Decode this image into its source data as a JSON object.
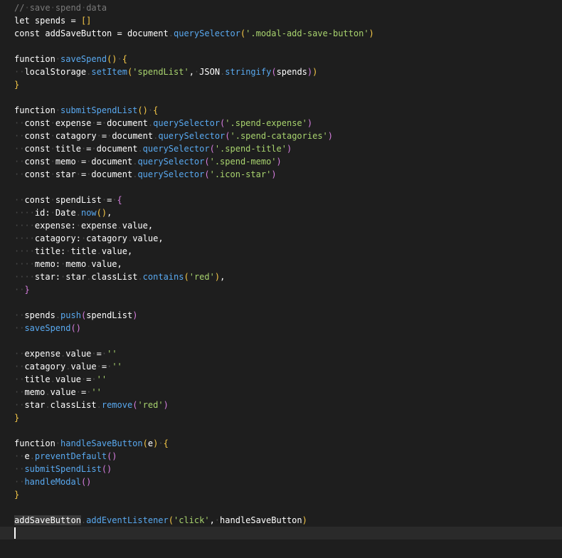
{
  "editor": {
    "colors": {
      "background": "#1e1e1e",
      "current_line": "#2a2a2a",
      "comment": "#7a7a7a",
      "function": "#59a9f0",
      "string": "#a8d36e",
      "paren": "#f7c948",
      "paren_nested": "#d77fe0",
      "whitespace": "#4a4a4a"
    },
    "lines": [
      [
        {
          "t": "//",
          "c": "comment"
        },
        {
          "t": "·",
          "c": "dot"
        },
        {
          "t": "save",
          "c": "comment"
        },
        {
          "t": "·",
          "c": "dot"
        },
        {
          "t": "spend",
          "c": "comment"
        },
        {
          "t": "·",
          "c": "dot"
        },
        {
          "t": "data",
          "c": "comment"
        }
      ],
      [
        {
          "t": "let",
          "c": "kw"
        },
        {
          "t": " spends = ",
          "c": "plain"
        },
        {
          "t": "[]",
          "c": "bracket"
        }
      ],
      [
        {
          "t": "const",
          "c": "kw"
        },
        {
          "t": " addSaveButton ",
          "c": "plain"
        },
        {
          "t": "=",
          "c": "plain"
        },
        {
          "t": " document",
          "c": "plain"
        },
        {
          "t": ".",
          "c": "dot"
        },
        {
          "t": "querySelector",
          "c": "fn"
        },
        {
          "t": "(",
          "c": "paren"
        },
        {
          "t": "'.modal-add-save-button'",
          "c": "string"
        },
        {
          "t": ")",
          "c": "paren"
        }
      ],
      [],
      [
        {
          "t": "function",
          "c": "kw"
        },
        {
          "t": "·",
          "c": "dot"
        },
        {
          "t": "saveSpend",
          "c": "fn"
        },
        {
          "t": "()",
          "c": "paren"
        },
        {
          "t": "·",
          "c": "dot"
        },
        {
          "t": "{",
          "c": "paren"
        }
      ],
      [
        {
          "t": "··",
          "c": "dot"
        },
        {
          "t": "localStorage",
          "c": "plain"
        },
        {
          "t": ".",
          "c": "dot"
        },
        {
          "t": "setItem",
          "c": "fn"
        },
        {
          "t": "(",
          "c": "paren"
        },
        {
          "t": "'spendList'",
          "c": "string"
        },
        {
          "t": ",",
          "c": "plain"
        },
        {
          "t": "·",
          "c": "dot"
        },
        {
          "t": "JSON",
          "c": "plain"
        },
        {
          "t": ".",
          "c": "dot"
        },
        {
          "t": "stringify",
          "c": "fn"
        },
        {
          "t": "(",
          "c": "paren2"
        },
        {
          "t": "spends",
          "c": "plain"
        },
        {
          "t": ")",
          "c": "paren2"
        },
        {
          "t": ")",
          "c": "paren"
        }
      ],
      [
        {
          "t": "}",
          "c": "paren"
        }
      ],
      [],
      [
        {
          "t": "function",
          "c": "kw"
        },
        {
          "t": "·",
          "c": "dot"
        },
        {
          "t": "submitSpendList",
          "c": "fn"
        },
        {
          "t": "()",
          "c": "paren"
        },
        {
          "t": "·",
          "c": "dot"
        },
        {
          "t": "{",
          "c": "paren"
        }
      ],
      [
        {
          "t": "··",
          "c": "dot"
        },
        {
          "t": "const",
          "c": "kw"
        },
        {
          "t": "·",
          "c": "dot"
        },
        {
          "t": "expense",
          "c": "plain"
        },
        {
          "t": "·",
          "c": "dot"
        },
        {
          "t": "=",
          "c": "plain"
        },
        {
          "t": "·",
          "c": "dot"
        },
        {
          "t": "document",
          "c": "plain"
        },
        {
          "t": ".",
          "c": "dot"
        },
        {
          "t": "querySelector",
          "c": "fn"
        },
        {
          "t": "(",
          "c": "paren2"
        },
        {
          "t": "'.spend-expense'",
          "c": "string"
        },
        {
          "t": ")",
          "c": "paren2"
        }
      ],
      [
        {
          "t": "··",
          "c": "dot"
        },
        {
          "t": "const",
          "c": "kw"
        },
        {
          "t": "·",
          "c": "dot"
        },
        {
          "t": "catagory",
          "c": "plain"
        },
        {
          "t": "·",
          "c": "dot"
        },
        {
          "t": "=",
          "c": "plain"
        },
        {
          "t": "·",
          "c": "dot"
        },
        {
          "t": "document",
          "c": "plain"
        },
        {
          "t": ".",
          "c": "dot"
        },
        {
          "t": "querySelector",
          "c": "fn"
        },
        {
          "t": "(",
          "c": "paren2"
        },
        {
          "t": "'.spend-catagories'",
          "c": "string"
        },
        {
          "t": ")",
          "c": "paren2"
        }
      ],
      [
        {
          "t": "··",
          "c": "dot"
        },
        {
          "t": "const",
          "c": "kw"
        },
        {
          "t": "·",
          "c": "dot"
        },
        {
          "t": "title",
          "c": "plain"
        },
        {
          "t": "·",
          "c": "dot"
        },
        {
          "t": "=",
          "c": "plain"
        },
        {
          "t": "·",
          "c": "dot"
        },
        {
          "t": "document",
          "c": "plain"
        },
        {
          "t": ".",
          "c": "dot"
        },
        {
          "t": "querySelector",
          "c": "fn"
        },
        {
          "t": "(",
          "c": "paren2"
        },
        {
          "t": "'.spend-title'",
          "c": "string"
        },
        {
          "t": ")",
          "c": "paren2"
        }
      ],
      [
        {
          "t": "··",
          "c": "dot"
        },
        {
          "t": "const",
          "c": "kw"
        },
        {
          "t": "·",
          "c": "dot"
        },
        {
          "t": "memo",
          "c": "plain"
        },
        {
          "t": "·",
          "c": "dot"
        },
        {
          "t": "=",
          "c": "plain"
        },
        {
          "t": "·",
          "c": "dot"
        },
        {
          "t": "document",
          "c": "plain"
        },
        {
          "t": ".",
          "c": "dot"
        },
        {
          "t": "querySelector",
          "c": "fn"
        },
        {
          "t": "(",
          "c": "paren2"
        },
        {
          "t": "'.spend-memo'",
          "c": "string"
        },
        {
          "t": ")",
          "c": "paren2"
        }
      ],
      [
        {
          "t": "··",
          "c": "dot"
        },
        {
          "t": "const",
          "c": "kw"
        },
        {
          "t": "·",
          "c": "dot"
        },
        {
          "t": "star",
          "c": "plain"
        },
        {
          "t": "·",
          "c": "dot"
        },
        {
          "t": "=",
          "c": "plain"
        },
        {
          "t": "·",
          "c": "dot"
        },
        {
          "t": "document",
          "c": "plain"
        },
        {
          "t": ".",
          "c": "dot"
        },
        {
          "t": "querySelector",
          "c": "fn"
        },
        {
          "t": "(",
          "c": "paren2"
        },
        {
          "t": "'.icon-star'",
          "c": "string"
        },
        {
          "t": ")",
          "c": "paren2"
        }
      ],
      [],
      [
        {
          "t": "··",
          "c": "dot"
        },
        {
          "t": "const",
          "c": "kw"
        },
        {
          "t": "·",
          "c": "dot"
        },
        {
          "t": "spendList",
          "c": "plain"
        },
        {
          "t": "·",
          "c": "dot"
        },
        {
          "t": "=",
          "c": "plain"
        },
        {
          "t": "·",
          "c": "dot"
        },
        {
          "t": "{",
          "c": "paren2"
        }
      ],
      [
        {
          "t": "····",
          "c": "dot"
        },
        {
          "t": "id:",
          "c": "plain"
        },
        {
          "t": "·",
          "c": "dot"
        },
        {
          "t": "Date",
          "c": "plain"
        },
        {
          "t": ".",
          "c": "dot"
        },
        {
          "t": "now",
          "c": "fn"
        },
        {
          "t": "()",
          "c": "paren"
        },
        {
          "t": ",",
          "c": "plain"
        }
      ],
      [
        {
          "t": "····",
          "c": "dot"
        },
        {
          "t": "expense:",
          "c": "plain"
        },
        {
          "t": "·",
          "c": "dot"
        },
        {
          "t": "expense",
          "c": "plain"
        },
        {
          "t": ".",
          "c": "dot"
        },
        {
          "t": "value",
          "c": "plain"
        },
        {
          "t": ",",
          "c": "plain"
        }
      ],
      [
        {
          "t": "····",
          "c": "dot"
        },
        {
          "t": "catagory:",
          "c": "plain"
        },
        {
          "t": "·",
          "c": "dot"
        },
        {
          "t": "catagory",
          "c": "plain"
        },
        {
          "t": ".",
          "c": "dot"
        },
        {
          "t": "value",
          "c": "plain"
        },
        {
          "t": ",",
          "c": "plain"
        }
      ],
      [
        {
          "t": "····",
          "c": "dot"
        },
        {
          "t": "title:",
          "c": "plain"
        },
        {
          "t": "·",
          "c": "dot"
        },
        {
          "t": "title",
          "c": "plain"
        },
        {
          "t": ".",
          "c": "dot"
        },
        {
          "t": "value",
          "c": "plain"
        },
        {
          "t": ",",
          "c": "plain"
        }
      ],
      [
        {
          "t": "····",
          "c": "dot"
        },
        {
          "t": "memo:",
          "c": "plain"
        },
        {
          "t": "·",
          "c": "dot"
        },
        {
          "t": "memo",
          "c": "plain"
        },
        {
          "t": ".",
          "c": "dot"
        },
        {
          "t": "value",
          "c": "plain"
        },
        {
          "t": ",",
          "c": "plain"
        }
      ],
      [
        {
          "t": "····",
          "c": "dot"
        },
        {
          "t": "star:",
          "c": "plain"
        },
        {
          "t": "·",
          "c": "dot"
        },
        {
          "t": "star",
          "c": "plain"
        },
        {
          "t": ".",
          "c": "dot"
        },
        {
          "t": "classList",
          "c": "plain"
        },
        {
          "t": ".",
          "c": "dot"
        },
        {
          "t": "contains",
          "c": "fn"
        },
        {
          "t": "(",
          "c": "paren"
        },
        {
          "t": "'red'",
          "c": "string"
        },
        {
          "t": ")",
          "c": "paren"
        },
        {
          "t": ",",
          "c": "plain"
        }
      ],
      [
        {
          "t": "··",
          "c": "dot"
        },
        {
          "t": "}",
          "c": "paren2"
        }
      ],
      [],
      [
        {
          "t": "··",
          "c": "dot"
        },
        {
          "t": "spends",
          "c": "plain"
        },
        {
          "t": ".",
          "c": "dot"
        },
        {
          "t": "push",
          "c": "fn"
        },
        {
          "t": "(",
          "c": "paren2"
        },
        {
          "t": "spendList",
          "c": "plain"
        },
        {
          "t": ")",
          "c": "paren2"
        }
      ],
      [
        {
          "t": "··",
          "c": "dot"
        },
        {
          "t": "saveSpend",
          "c": "fn"
        },
        {
          "t": "()",
          "c": "paren2"
        }
      ],
      [],
      [
        {
          "t": "··",
          "c": "dot"
        },
        {
          "t": "expense",
          "c": "plain"
        },
        {
          "t": ".",
          "c": "dot"
        },
        {
          "t": "value",
          "c": "plain"
        },
        {
          "t": "·",
          "c": "dot"
        },
        {
          "t": "=",
          "c": "plain"
        },
        {
          "t": "·",
          "c": "dot"
        },
        {
          "t": "''",
          "c": "string"
        }
      ],
      [
        {
          "t": "··",
          "c": "dot"
        },
        {
          "t": "catagory",
          "c": "plain"
        },
        {
          "t": ".",
          "c": "dot"
        },
        {
          "t": "value",
          "c": "plain"
        },
        {
          "t": "·",
          "c": "dot"
        },
        {
          "t": "=",
          "c": "plain"
        },
        {
          "t": "·",
          "c": "dot"
        },
        {
          "t": "''",
          "c": "string"
        }
      ],
      [
        {
          "t": "··",
          "c": "dot"
        },
        {
          "t": "title",
          "c": "plain"
        },
        {
          "t": ".",
          "c": "dot"
        },
        {
          "t": "value",
          "c": "plain"
        },
        {
          "t": "·",
          "c": "dot"
        },
        {
          "t": "=",
          "c": "plain"
        },
        {
          "t": "·",
          "c": "dot"
        },
        {
          "t": "''",
          "c": "string"
        }
      ],
      [
        {
          "t": "··",
          "c": "dot"
        },
        {
          "t": "memo",
          "c": "plain"
        },
        {
          "t": ".",
          "c": "dot"
        },
        {
          "t": "value",
          "c": "plain"
        },
        {
          "t": "·",
          "c": "dot"
        },
        {
          "t": "=",
          "c": "plain"
        },
        {
          "t": "·",
          "c": "dot"
        },
        {
          "t": "''",
          "c": "string"
        }
      ],
      [
        {
          "t": "··",
          "c": "dot"
        },
        {
          "t": "star",
          "c": "plain"
        },
        {
          "t": ".",
          "c": "dot"
        },
        {
          "t": "classList",
          "c": "plain"
        },
        {
          "t": ".",
          "c": "dot"
        },
        {
          "t": "remove",
          "c": "fn"
        },
        {
          "t": "(",
          "c": "paren2"
        },
        {
          "t": "'red'",
          "c": "string"
        },
        {
          "t": ")",
          "c": "paren2"
        }
      ],
      [
        {
          "t": "}",
          "c": "paren"
        }
      ],
      [],
      [
        {
          "t": "function",
          "c": "kw"
        },
        {
          "t": "·",
          "c": "dot"
        },
        {
          "t": "handleSaveButton",
          "c": "fn"
        },
        {
          "t": "(",
          "c": "paren"
        },
        {
          "t": "e",
          "c": "plain"
        },
        {
          "t": ")",
          "c": "paren"
        },
        {
          "t": "·",
          "c": "dot"
        },
        {
          "t": "{",
          "c": "paren"
        }
      ],
      [
        {
          "t": "··",
          "c": "dot"
        },
        {
          "t": "e",
          "c": "plain"
        },
        {
          "t": ".",
          "c": "dot"
        },
        {
          "t": "preventDefault",
          "c": "fn"
        },
        {
          "t": "()",
          "c": "paren2"
        }
      ],
      [
        {
          "t": "··",
          "c": "dot"
        },
        {
          "t": "submitSpendList",
          "c": "fn"
        },
        {
          "t": "()",
          "c": "paren2"
        }
      ],
      [
        {
          "t": "··",
          "c": "dot"
        },
        {
          "t": "handleModal",
          "c": "fn"
        },
        {
          "t": "()",
          "c": "paren2"
        }
      ],
      [
        {
          "t": "}",
          "c": "paren"
        }
      ],
      [],
      [
        {
          "t": "addSaveButton",
          "c": "hl"
        },
        {
          "t": ".",
          "c": "dot"
        },
        {
          "t": "addEventListener",
          "c": "fn"
        },
        {
          "t": "(",
          "c": "paren"
        },
        {
          "t": "'click'",
          "c": "string"
        },
        {
          "t": ",",
          "c": "plain"
        },
        {
          "t": "·",
          "c": "dot"
        },
        {
          "t": "handleSaveButton",
          "c": "plain"
        },
        {
          "t": ")",
          "c": "paren"
        }
      ],
      []
    ],
    "current_line_index": 41
  }
}
